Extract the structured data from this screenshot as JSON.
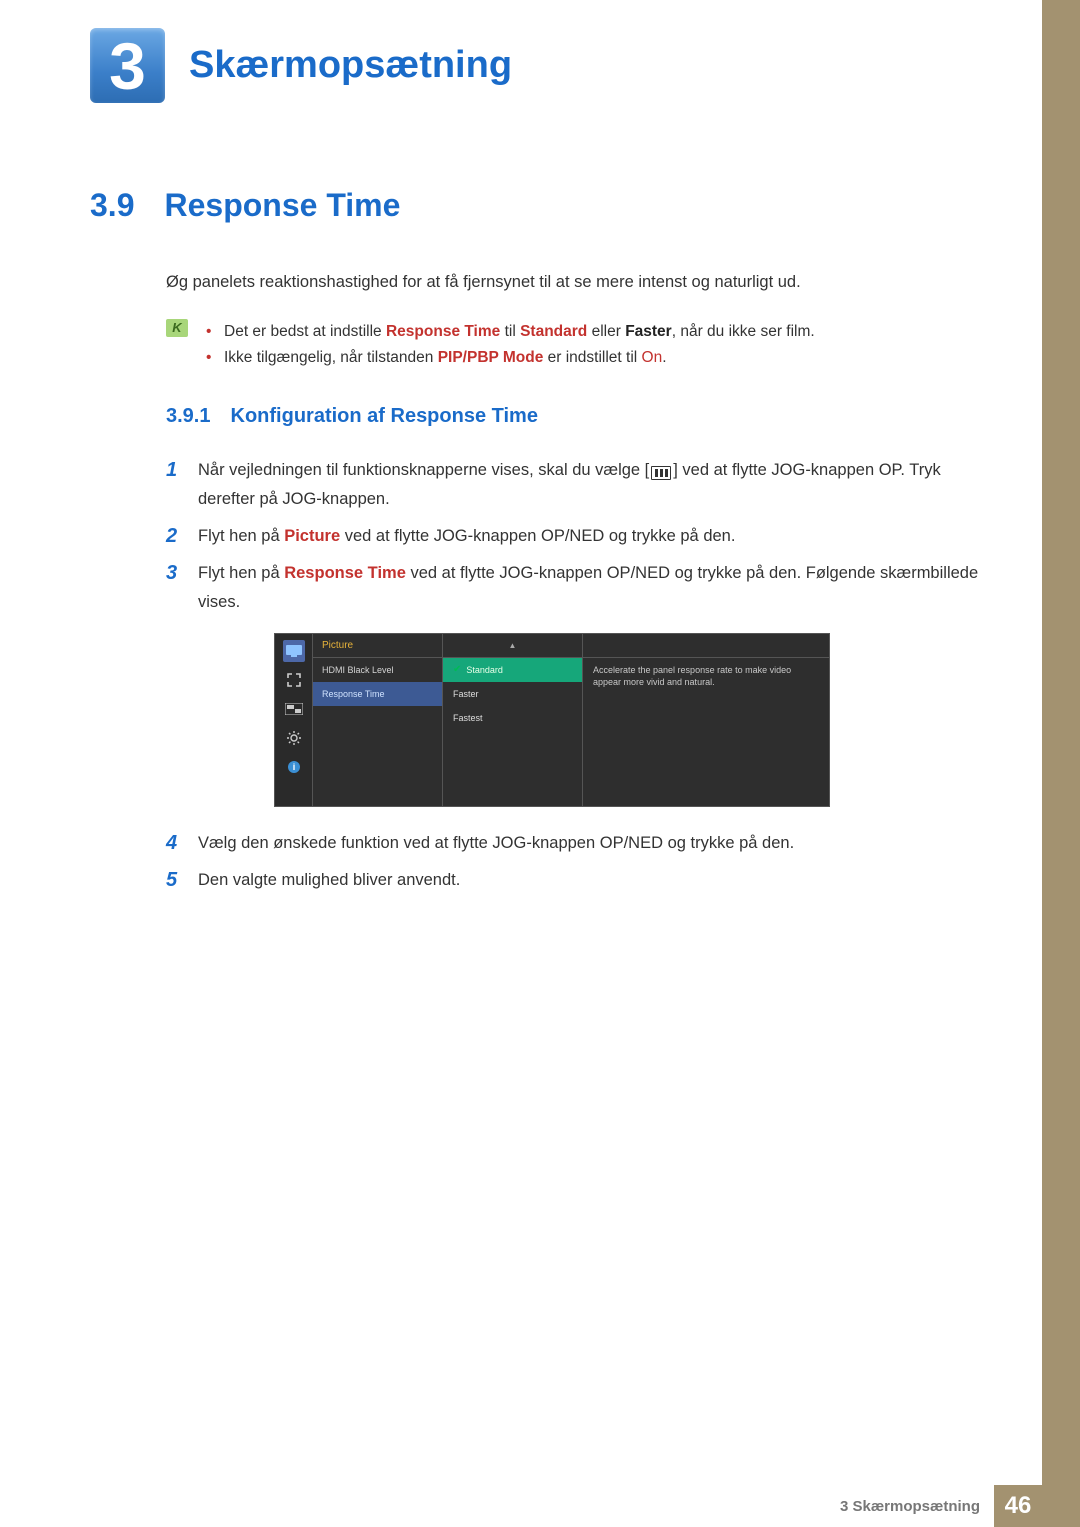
{
  "chapter": {
    "number": "3",
    "title": "Skærmopsætning"
  },
  "section": {
    "number": "3.9",
    "title": "Response Time"
  },
  "intro": "Øg panelets reaktionshastighed for at få fjernsynet til at se mere intenst og naturligt ud.",
  "notes": {
    "items": [
      {
        "pre": "Det er bedst at indstille ",
        "em1": "Response Time",
        "mid1": " til ",
        "em2": "Standard",
        "mid2": " eller ",
        "em3": "Faster",
        "post": ", når du ikke ser film."
      },
      {
        "pre": "Ikke tilgængelig, når tilstanden ",
        "em1": "PIP/PBP Mode",
        "mid1": " er indstillet til ",
        "em2": "On",
        "post": "."
      }
    ]
  },
  "subsection": {
    "number": "3.9.1",
    "title": "Konfiguration af Response Time"
  },
  "steps": {
    "s1a": "Når vejledningen til funktionsknapperne vises, skal du vælge [",
    "s1b": "] ved at flytte JOG-knappen OP. Tryk derefter på JOG-knappen.",
    "s2a": "Flyt hen på ",
    "s2em": "Picture",
    "s2b": " ved at flytte JOG-knappen OP/NED og trykke på den.",
    "s3a": "Flyt hen på ",
    "s3em": "Response Time",
    "s3b": " ved at flytte JOG-knappen OP/NED og trykke på den. Følgende skærmbillede vises.",
    "s4": "Vælg den ønskede funktion ved at flytte JOG-knappen OP/NED og trykke på den.",
    "s5": "Den valgte mulighed bliver anvendt."
  },
  "osd": {
    "menuHead": "Picture",
    "menuItem1": "HDMI Black Level",
    "menuItem2": "Response Time",
    "arrow": "▲",
    "opt1": "Standard",
    "opt2": "Faster",
    "opt3": "Fastest",
    "desc": "Accelerate the panel response rate to make video appear more vivid and natural."
  },
  "footer": {
    "label": "3 Skærmopsætning",
    "page": "46"
  }
}
